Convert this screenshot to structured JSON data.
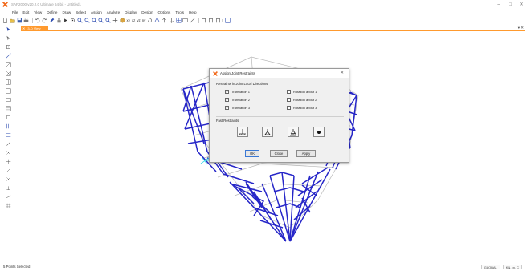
{
  "window": {
    "title": "SAP2000 v20.2.0 Ultimate 64-bit - Untitled1",
    "minimize": "–",
    "maximize": "□",
    "close": "✕"
  },
  "menu": [
    "File",
    "Edit",
    "View",
    "Define",
    "Draw",
    "Select",
    "Assign",
    "Analyze",
    "Display",
    "Design",
    "Options",
    "Tools",
    "Help"
  ],
  "toolbar": {
    "text_items": [
      "xy",
      "xz",
      "yz",
      "nv",
      "I"
    ],
    "icons": [
      "new-icon",
      "open-icon",
      "save-icon",
      "undo-icon",
      "redo-icon",
      "pencil-icon",
      "lock-icon",
      "run-icon",
      "zoom-icon",
      "pan-icon",
      "3d-view-icon",
      "perspective-icon"
    ]
  },
  "view": {
    "tab_close": "✕",
    "tab_label": "3-D View",
    "controls": "▾ ✕"
  },
  "status": {
    "text": "5 Points Selected",
    "coord_system": "GLOBAL",
    "units": "KN, m, C"
  },
  "dialog": {
    "title": "Assign Joint Restraints",
    "close": "✕",
    "group1_label": "Restraints in Joint Local Directions",
    "translation": [
      {
        "label": "Translation 1",
        "checked": true
      },
      {
        "label": "Translation 2",
        "checked": true
      },
      {
        "label": "Translation 3",
        "checked": true
      }
    ],
    "rotation": [
      {
        "label": "Rotation about 1",
        "checked": false
      },
      {
        "label": "Rotation about 2",
        "checked": false
      },
      {
        "label": "Rotation about 3",
        "checked": false
      }
    ],
    "check_mark": "✓",
    "group2_label": "Fast Restraints",
    "fast_restraints": [
      "fixed-support-icon",
      "pinned-support-icon",
      "roller-support-icon",
      "free-joint-icon"
    ],
    "buttons": {
      "ok": "OK",
      "close": "Close",
      "apply": "Apply"
    }
  },
  "colors": {
    "frame_blue": "#2626c8",
    "frame_grey": "#b8b8b8",
    "tab_orange": "#ff9a2e",
    "logo_orange": "#f26b1d",
    "selection_cyan": "#3ad8e8"
  }
}
